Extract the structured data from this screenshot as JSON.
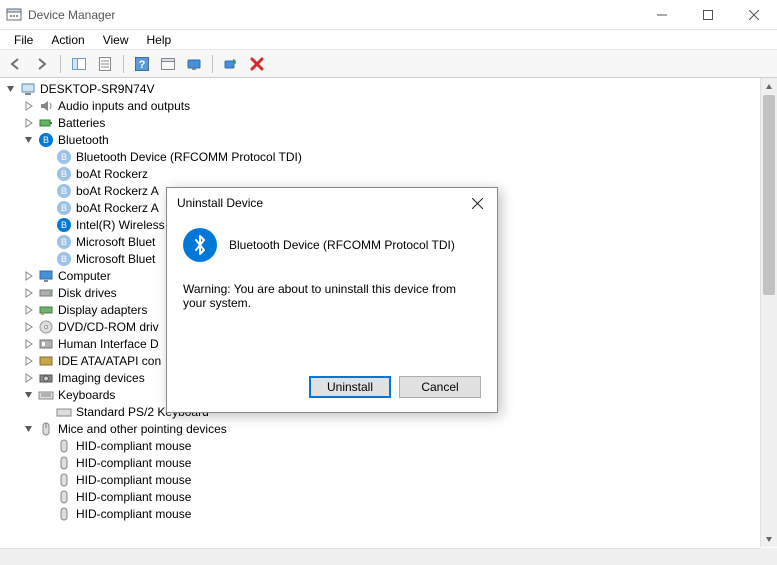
{
  "window": {
    "title": "Device Manager"
  },
  "menu": {
    "file": "File",
    "action": "Action",
    "view": "View",
    "help": "Help"
  },
  "toolbar": {
    "back": "back",
    "forward": "forward",
    "show_hidden": "show-hidden",
    "properties": "properties",
    "help": "help",
    "options": "options",
    "display": "display",
    "scan": "scan",
    "remove": "remove"
  },
  "tree": {
    "root": {
      "label": "DESKTOP-SR9N74V"
    },
    "audio": {
      "label": "Audio inputs and outputs"
    },
    "batteries": {
      "label": "Batteries"
    },
    "bluetooth": {
      "label": "Bluetooth",
      "children": {
        "rfcomm": "Bluetooth Device (RFCOMM Protocol TDI)",
        "boat1": "boAt Rockerz",
        "boat2": "boAt Rockerz A",
        "boat3": "boAt Rockerz A",
        "intel": "Intel(R) Wireless",
        "msbt1": "Microsoft Bluet",
        "msbt2": "Microsoft Bluet"
      }
    },
    "computer": {
      "label": "Computer"
    },
    "disk": {
      "label": "Disk drives"
    },
    "display": {
      "label": "Display adapters"
    },
    "dvd": {
      "label": "DVD/CD-ROM driv"
    },
    "hid": {
      "label": "Human Interface D"
    },
    "ide": {
      "label": "IDE ATA/ATAPI con"
    },
    "imaging": {
      "label": "Imaging devices"
    },
    "keyboards": {
      "label": "Keyboards",
      "std": "Standard PS/2 Keyboard"
    },
    "mice": {
      "label": "Mice and other pointing devices",
      "m1": "HID-compliant mouse",
      "m2": "HID-compliant mouse",
      "m3": "HID-compliant mouse",
      "m4": "HID-compliant mouse",
      "m5": "HID-compliant mouse"
    }
  },
  "dialog": {
    "title": "Uninstall Device",
    "device": "Bluetooth Device (RFCOMM Protocol TDI)",
    "warning": "Warning: You are about to uninstall this device from your system.",
    "uninstall": "Uninstall",
    "cancel": "Cancel"
  }
}
